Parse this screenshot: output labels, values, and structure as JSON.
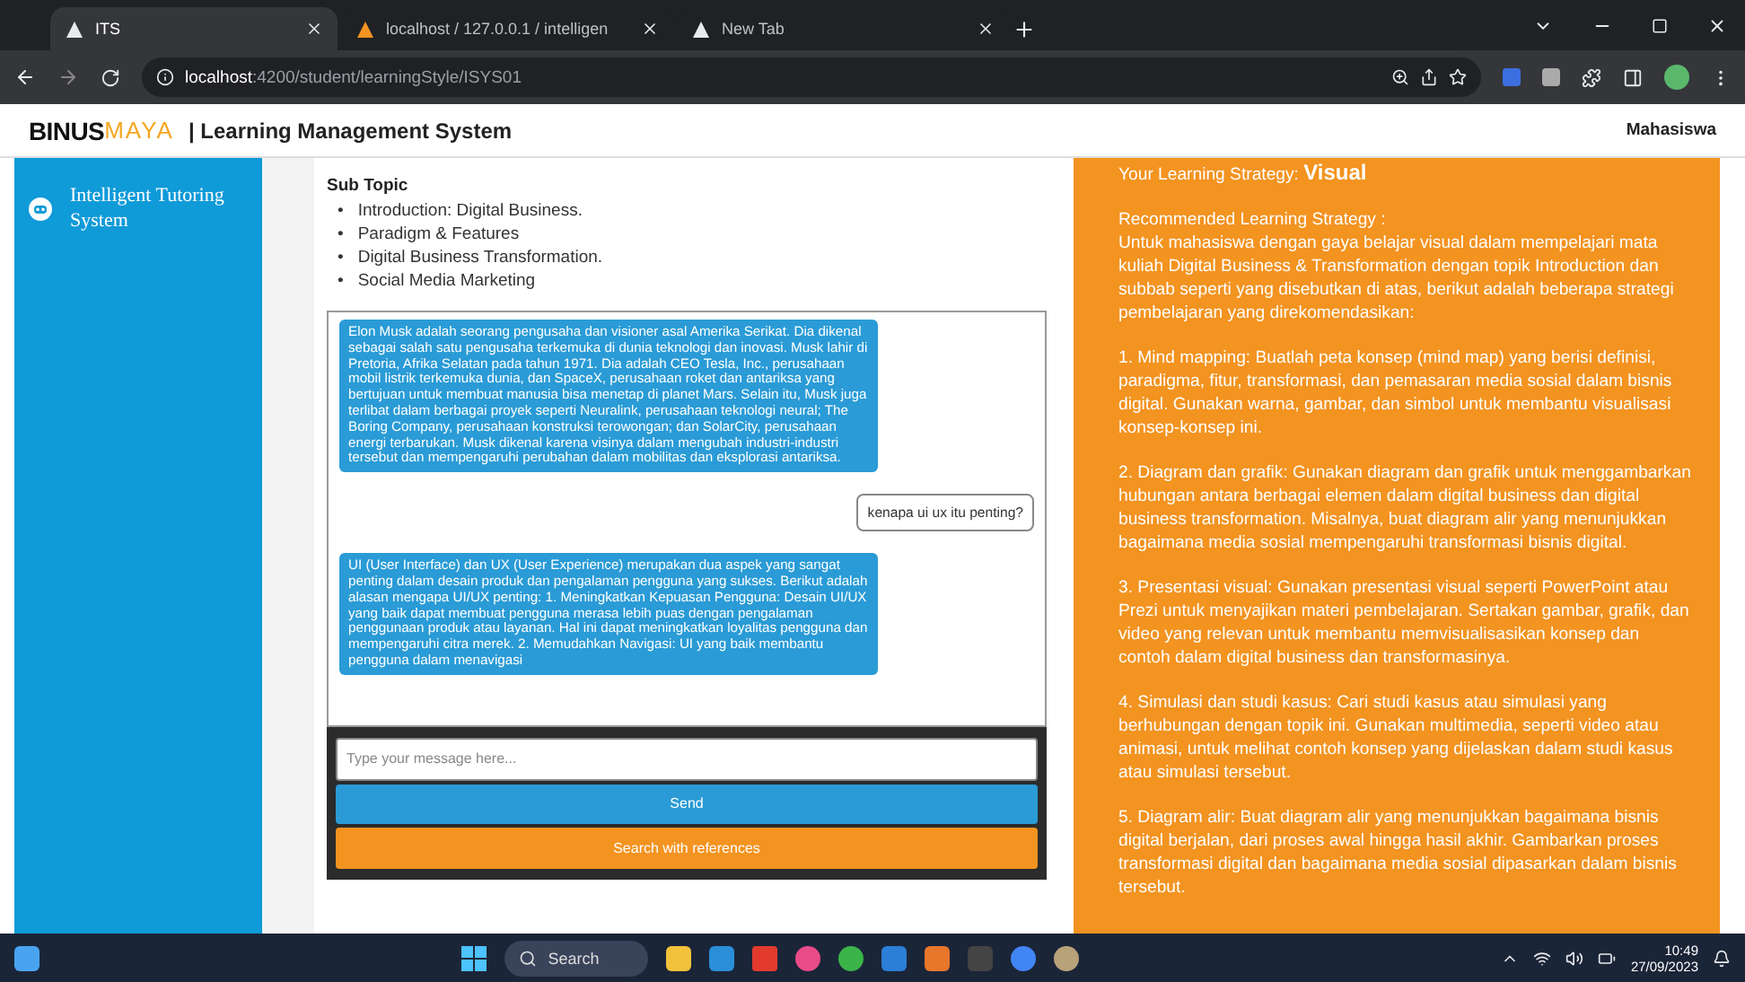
{
  "browser": {
    "tabs": [
      {
        "title": "ITS",
        "selected": true
      },
      {
        "title": "localhost / 127.0.0.1 / intelligen",
        "selected": false
      },
      {
        "title": "New Tab",
        "selected": false
      }
    ],
    "url_host": "localhost",
    "url_path": ":4200/student/learningStyle/ISYS01"
  },
  "header": {
    "brand_main": "BINUS",
    "brand_accent": "MAYA",
    "title": "| Learning Management System",
    "user": "Mahasiswa"
  },
  "sidebar": {
    "items": [
      {
        "label": "Intelligent Tutoring System",
        "selected": true
      }
    ]
  },
  "subtopic": {
    "heading": "Sub Topic",
    "marker": "•",
    "items": [
      "Introduction: Digital Business.",
      "Paradigm & Features",
      "Digital Business Transformation.",
      "Social Media Marketing"
    ]
  },
  "chat": {
    "messages": [
      {
        "kind": "bot",
        "text": "Elon Musk adalah seorang pengusaha dan visioner asal Amerika Serikat. Dia dikenal sebagai salah satu pengusaha terkemuka di dunia teknologi dan inovasi. Musk lahir di Pretoria, Afrika Selatan pada tahun 1971. Dia adalah CEO Tesla, Inc., perusahaan mobil listrik terkemuka dunia, dan SpaceX, perusahaan roket dan antariksa yang bertujuan untuk membuat manusia bisa menetap di planet Mars. Selain itu, Musk juga terlibat dalam berbagai proyek seperti Neuralink, perusahaan teknologi neural; The Boring Company, perusahaan konstruksi terowongan; dan SolarCity, perusahaan energi terbarukan. Musk dikenal karena visinya dalam mengubah industri-industri tersebut dan mempengaruhi perubahan dalam mobilitas dan eksplorasi antariksa."
      },
      {
        "kind": "user",
        "text": "kenapa ui ux itu penting?"
      },
      {
        "kind": "bot",
        "text": "UI (User Interface) dan UX (User Experience) merupakan dua aspek yang sangat penting dalam desain produk dan pengalaman pengguna yang sukses. Berikut adalah alasan mengapa UI/UX penting: 1. Meningkatkan Kepuasan Pengguna: Desain UI/UX yang baik dapat membuat pengguna merasa lebih puas dengan pengalaman penggunaan produk atau layanan. Hal ini dapat meningkatkan loyalitas pengguna dan mempengaruhi citra merek. 2. Memudahkan Navigasi: UI yang baik membantu pengguna dalam menavigasi"
      }
    ],
    "placeholder": "Type your message here...",
    "send": "Send",
    "search": "Search with references"
  },
  "strategy": {
    "label": "Your Learning Strategy:",
    "value": "Visual",
    "recommended": "Recommended Learning Strategy :",
    "intro": "Untuk mahasiswa dengan gaya belajar visual dalam mempelajari mata kuliah Digital Business & Transformation dengan topik Introduction dan subbab seperti yang disebutkan di atas, berikut adalah beberapa strategi pembelajaran yang direkomendasikan:",
    "points": [
      "1. Mind mapping: Buatlah peta konsep (mind map) yang berisi definisi, paradigma, fitur, transformasi, dan pemasaran media sosial dalam bisnis digital. Gunakan warna, gambar, dan simbol untuk membantu visualisasi konsep-konsep ini.",
      "2. Diagram dan grafik: Gunakan diagram dan grafik untuk menggambarkan hubungan antara berbagai elemen dalam digital business dan digital business transformation. Misalnya, buat diagram alir yang menunjukkan bagaimana media sosial mempengaruhi transformasi bisnis digital.",
      "3. Presentasi visual: Gunakan presentasi visual seperti PowerPoint atau Prezi untuk menyajikan materi pembelajaran. Sertakan gambar, grafik, dan video yang relevan untuk membantu memvisualisasikan konsep dan contoh dalam digital business dan transformasinya.",
      "4. Simulasi dan studi kasus: Cari studi kasus atau simulasi yang berhubungan dengan topik ini. Gunakan multimedia, seperti video atau animasi, untuk melihat contoh konsep yang dijelaskan dalam studi kasus atau simulasi tersebut.",
      "5. Diagram alir: Buat diagram alir yang menunjukkan bagaimana bisnis digital berjalan, dari proses awal hingga hasil akhir. Gambarkan proses transformasi digital dan bagaimana media sosial dipasarkan dalam bisnis tersebut."
    ]
  },
  "taskbar": {
    "search": "Search",
    "time": "10:49",
    "date": "27/09/2023"
  }
}
